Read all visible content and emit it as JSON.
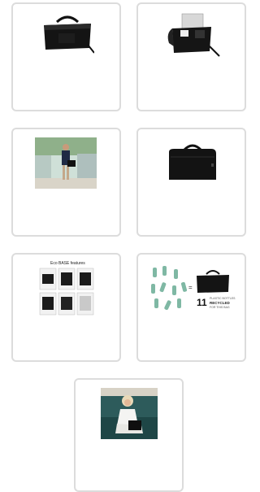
{
  "gallery": {
    "items": [
      {
        "label": "Eco BASE Bag",
        "icon": "laptop-bag-icon"
      },
      {
        "label": "Open bag",
        "icon": "open-bag-icon"
      },
      {
        "label": "Man with bag",
        "icon": "lifestyle-photo"
      },
      {
        "label": "Bag front",
        "icon": "laptop-bag-icon"
      },
      {
        "label": "Eco BASE features",
        "icon": "feature-grid"
      },
      {
        "label": "Recycled bottles",
        "icon": "recycled-bottles"
      },
      {
        "label": "Woman with bag",
        "icon": "lifestyle-photo"
      }
    ],
    "features_title": "Eco BASE features",
    "recycle_number": "11",
    "recycle_line1": "PLASTIC BOTTLES",
    "recycle_line2": "RECYCLED",
    "recycle_line3": "FOR THIS BAG"
  },
  "colors": {
    "card_border": "#dcdcdc",
    "bag": "#111111",
    "bottle": "#7fb8a4"
  }
}
